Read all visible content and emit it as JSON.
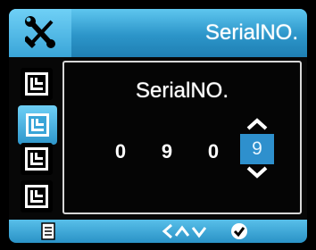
{
  "header": {
    "title": "SerialNO.",
    "icon": "tools-icon"
  },
  "sidebar": {
    "items": [
      {
        "name": "sidebar-item-1",
        "icon": "menu-page-icon"
      },
      {
        "name": "sidebar-item-2",
        "icon": "menu-page-icon",
        "active": true
      },
      {
        "name": "sidebar-item-3",
        "icon": "menu-page-icon"
      },
      {
        "name": "sidebar-item-4",
        "icon": "menu-page-icon"
      }
    ]
  },
  "panel": {
    "title": "SerialNO.",
    "digits": [
      "0",
      "9",
      "0",
      "9"
    ],
    "selected_index": 3
  },
  "footer": {
    "icons": [
      "document-icon",
      "left-up-down-icon",
      "confirm-icon"
    ]
  },
  "colors": {
    "accent": "#2e90cd",
    "header": "#3aa5d8"
  }
}
